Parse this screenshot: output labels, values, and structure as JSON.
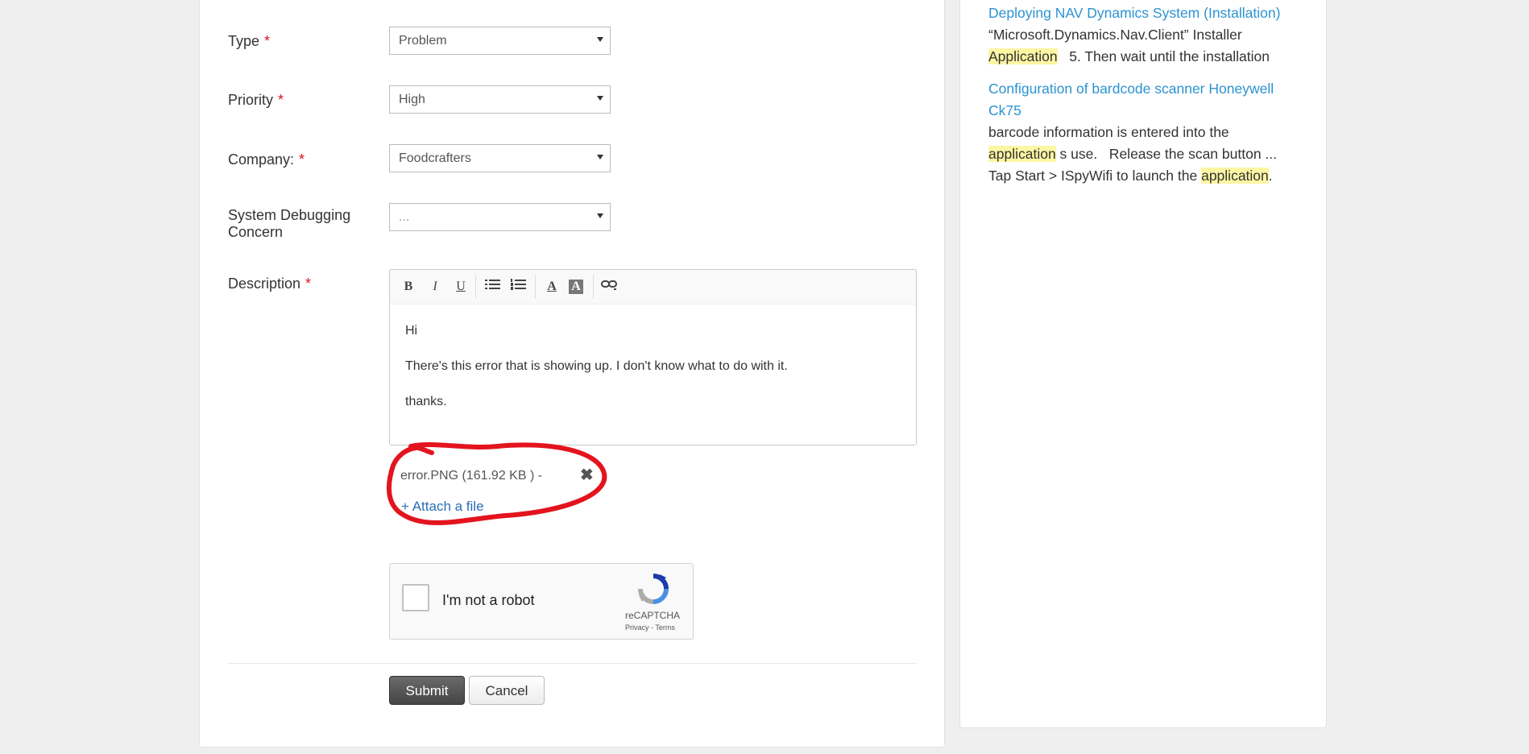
{
  "form": {
    "type": {
      "label": "Type",
      "required": "*",
      "value": "Problem"
    },
    "priority": {
      "label": "Priority",
      "required": "*",
      "value": "High"
    },
    "company": {
      "label": "Company:",
      "required": "*",
      "value": "Foodcrafters"
    },
    "debugging": {
      "label_line1": "System Debugging",
      "label_line2": "Concern",
      "value": "..."
    },
    "description": {
      "label": "Description",
      "required": "*",
      "lines": [
        "Hi",
        "There's this error that is showing up. I don't know what to do with it.",
        "thanks."
      ]
    },
    "toolbar": {
      "bold": "B",
      "italic": "I",
      "underline": "U",
      "bullets": "bulleted-list-icon",
      "numbers": "numbered-list-icon",
      "text_color": "A",
      "bg_color": "A",
      "link": "link-icon"
    },
    "attachment": {
      "file": "error.PNG (161.92 KB ) -",
      "remove": "✖",
      "attach_link": "+ Attach a file"
    },
    "captcha": {
      "label": "I'm not a robot",
      "brand": "reCAPTCHA",
      "privacy": "Privacy",
      "separator": "-",
      "terms": "Terms"
    },
    "buttons": {
      "submit": "Submit",
      "cancel": "Cancel"
    }
  },
  "kb_results": [
    {
      "title": "Deploying NAV Dynamics System (Installation)",
      "snippet_parts": [
        {
          "text": "“Microsoft.Dynamics.Nav.Client” Installer",
          "hl": false
        },
        {
          "text": "Application",
          "hl": true
        },
        {
          "text": "   5. Then wait until the installation",
          "hl": false
        }
      ]
    },
    {
      "title": "Configuration of bardcode scanner Honeywell Ck75",
      "snippet_parts": [
        {
          "text": "barcode information is entered into the",
          "hl": false
        },
        {
          "text": "application",
          "hl": true
        },
        {
          "text": " s use.   Release the scan button ...",
          "hl": false
        },
        {
          "text": "Tap Start > ISpyWifi to launch the ",
          "hl": false
        },
        {
          "text": "application",
          "hl": true
        },
        {
          "text": ".",
          "hl": false
        }
      ]
    }
  ],
  "colors": {
    "required": "#d9141e",
    "link": "#2b93d1",
    "highlight": "#fdf6a3",
    "annotation": "#e3141e"
  }
}
